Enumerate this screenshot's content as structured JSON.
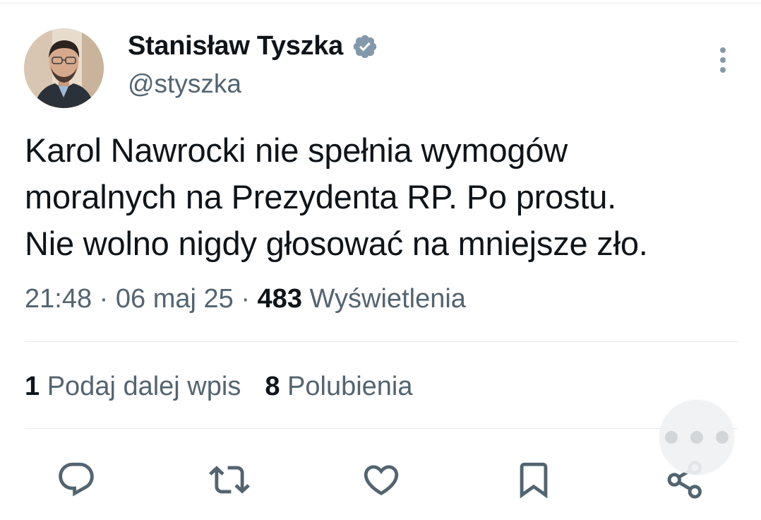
{
  "author": {
    "name": "Stanisław Tyszka",
    "handle": "@styszka"
  },
  "tweet": {
    "text_lines": [
      "Karol Nawrocki nie spełnia wymogów",
      "moralnych na Prezydenta RP. Po prostu.",
      "Nie wolno nigdy głosować na mniejsze zło."
    ],
    "time": "21:48",
    "date": "06 maj 25",
    "separator": "·",
    "views_count": "483",
    "views_label": "Wyświetlenia"
  },
  "stats": {
    "reposts_count": "1",
    "reposts_label": "Podaj dalej wpis",
    "likes_count": "8",
    "likes_label": "Polubienia"
  },
  "icons": {
    "verified": "verified-badge-icon",
    "more": "more-vertical-icon",
    "reply": "reply-icon",
    "repost": "repost-icon",
    "like": "heart-icon",
    "bookmark": "bookmark-icon",
    "share": "share-icon",
    "floating": "more-horizontal-icon"
  },
  "colors": {
    "text": "#0f1419",
    "secondary": "#536471",
    "divider": "#e6e9ec",
    "verified": "#829aab"
  }
}
